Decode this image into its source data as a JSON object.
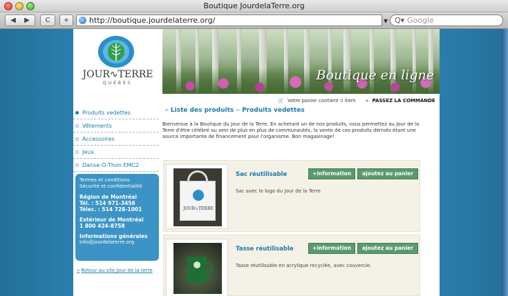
{
  "window": {
    "title": "Boutique JourdelaTerre.org"
  },
  "toolbar": {
    "back_label": "◀",
    "forward_label": "▶",
    "reload_label": "C",
    "newtab_label": "+",
    "url": "http://boutique.jourdelaterre.org/",
    "search_placeholder": "Google"
  },
  "header": {
    "logo_text": "JOUR∿TERRE",
    "logo_subtext": "QUÉBEC",
    "banner_title": "Boutique en ligne"
  },
  "cart": {
    "text_prefix": "Votre panier contient",
    "count": "0",
    "text_suffix": "item",
    "arrows": "»",
    "cta": "PASSEZ LA COMMANDE"
  },
  "sidebar": {
    "items": [
      {
        "label": "Produits vedettes",
        "active": true
      },
      {
        "label": "Vêtements",
        "active": false
      },
      {
        "label": "Accessoires",
        "active": false
      },
      {
        "label": "Jeux",
        "active": false
      },
      {
        "label": "Danse-O-Thon EMC2",
        "active": false
      }
    ],
    "info": {
      "terms": "Termes et conditions",
      "security": "Sécurité et confidentialité",
      "region_title": "Région de Montréal",
      "tel": "Tél. : 514 971-3456",
      "fax": "Télec. : 514 728-1001",
      "outside_title": "Extérieur de Montréal",
      "outside_phone": "1 800 424-8758",
      "general_title": "Informations générales",
      "email": "info@jourdelaterre.org"
    },
    "back_link": "Retour au site Jour de la terre",
    "back_arrow": "«"
  },
  "main": {
    "breadcrumb": {
      "sep": "»",
      "root": "Liste des produits",
      "current": "Produits vedettes"
    },
    "intro": "Bienvenue à la Boutique du Jour de la Terre. En achetant un de nos produits, vous permettez au Jour de la Terre d'être célébré au sein de plus en plus de communautés, la vente de ces produits dérivés étant une source importante de financement pour l'organisme. Bon magasinage!",
    "products": [
      {
        "name": "Sac réutilisable",
        "description": "Sac avec le logo du Jour de la Terre",
        "thumb_text": "JOUR∿TERRE",
        "info_button": "+information",
        "cart_button": "ajoutez au panier"
      },
      {
        "name": "Tasse réutilisable",
        "description": "Tasse réutilisable en acrylique recyclée, avec couvercle.",
        "info_button": "+information",
        "cart_button": "ajoutez au panier"
      }
    ]
  },
  "colors": {
    "accent": "#1f7aa8",
    "info_box": "#3b94c5",
    "button": "#5b9a6e",
    "cta_arrows": "#d83232"
  }
}
